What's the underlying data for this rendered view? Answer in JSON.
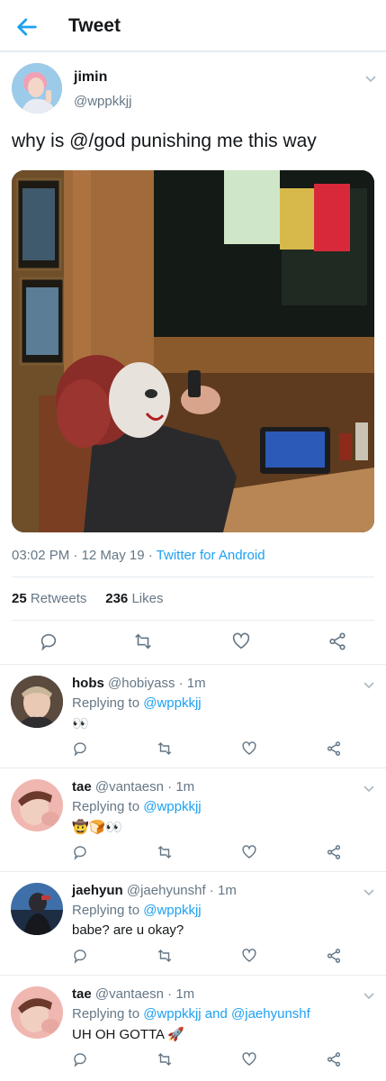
{
  "header": {
    "title": "Tweet"
  },
  "tweet": {
    "author_name": "jimin",
    "author_handle": "@wppkkjj",
    "text": "why is @/god punishing me this way",
    "time": "03:02 PM",
    "date": "12 May 19",
    "source": "Twitter for Android",
    "retweets": "25",
    "retweets_label": "Retweets",
    "likes": "236",
    "likes_label": "Likes",
    "separator": " · "
  },
  "replies": [
    {
      "name": "hobs",
      "handle": "@hobiyass",
      "time": "1m",
      "replying_label": "Replying to",
      "mention": "@wppkkjj",
      "mention2": "",
      "and": "",
      "body": "👀"
    },
    {
      "name": "tae",
      "handle": "@vantaesn",
      "time": "1m",
      "replying_label": "Replying to",
      "mention": "@wppkkjj",
      "mention2": "",
      "and": "",
      "body": "🤠🍞👀"
    },
    {
      "name": "jaehyun",
      "handle": "@jaehyunshf",
      "time": "1m",
      "replying_label": "Replying to",
      "mention": "@wppkkjj",
      "mention2": "",
      "and": "",
      "body": "babe? are u okay?"
    },
    {
      "name": "tae",
      "handle": "@vantaesn",
      "time": "1m",
      "replying_label": "Replying to",
      "mention": "@wppkkjj",
      "mention2": "@jaehyunshf",
      "and": " and ",
      "body": "UH OH GOTTA 🚀"
    }
  ],
  "colors": {
    "accent": "#1da1f2",
    "secondary_text": "#657786",
    "divider": "#e6ecf0"
  },
  "icons": [
    "back-arrow-icon",
    "chevron-down-icon",
    "reply-icon",
    "retweet-icon",
    "like-icon",
    "share-icon"
  ]
}
